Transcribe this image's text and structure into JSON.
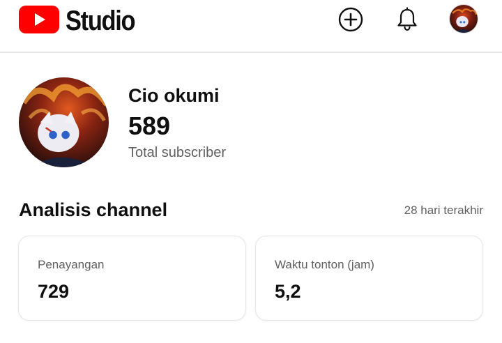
{
  "header": {
    "logo_text": "Studio",
    "logo_icon": "youtube-play-icon",
    "brand_color": "#ff0000",
    "actions": [
      {
        "icon": "create-plus-icon"
      },
      {
        "icon": "bell-icon"
      },
      {
        "icon": "account-avatar"
      }
    ]
  },
  "channel": {
    "name": "Cio okumi",
    "subscribers": "589",
    "subscribers_label": "Total subscriber"
  },
  "analytics": {
    "title": "Analisis channel",
    "period": "28 hari terakhir",
    "cards": [
      {
        "label": "Penayangan",
        "value": "729"
      },
      {
        "label": "Waktu tonton (jam)",
        "value": "5,2"
      }
    ]
  }
}
